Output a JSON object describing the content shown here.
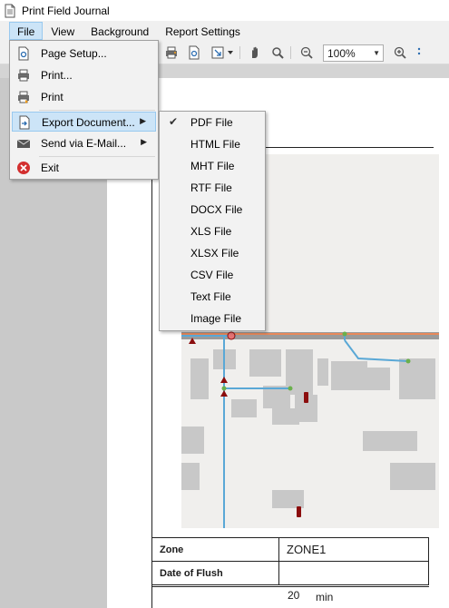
{
  "window": {
    "title": "Print Field Journal"
  },
  "menubar": {
    "items": [
      "File",
      "View",
      "Background",
      "Report Settings"
    ]
  },
  "toolbar": {
    "zoom_value": "100%"
  },
  "file_menu": {
    "items": [
      {
        "label": "Page Setup...",
        "icon": "page-setup-icon"
      },
      {
        "label": "Print...",
        "icon": "printer-icon"
      },
      {
        "label": "Print",
        "icon": "quick-print-icon"
      },
      {
        "label": "Export Document...",
        "icon": "export-icon",
        "submenu": true
      },
      {
        "label": "Send via E-Mail...",
        "icon": "mail-icon",
        "submenu": true
      },
      {
        "label": "Exit",
        "icon": "exit-icon"
      }
    ]
  },
  "export_menu": {
    "items": [
      "PDF File",
      "HTML File",
      "MHT File",
      "RTF File",
      "DOCX File",
      "XLS File",
      "XLSX File",
      "CSV File",
      "Text File",
      "Image File"
    ],
    "checked": "PDF File"
  },
  "report": {
    "rows": [
      {
        "label": "Zone",
        "value": "ZONE1"
      },
      {
        "label": "Date of Flush",
        "value": ""
      }
    ],
    "partial_value": "20",
    "partial_unit": "min"
  },
  "colors": {
    "accent": "#cce4f7",
    "accent_border": "#99c9ef",
    "pipe": "#5aa8d6",
    "road": "#e8895a"
  }
}
